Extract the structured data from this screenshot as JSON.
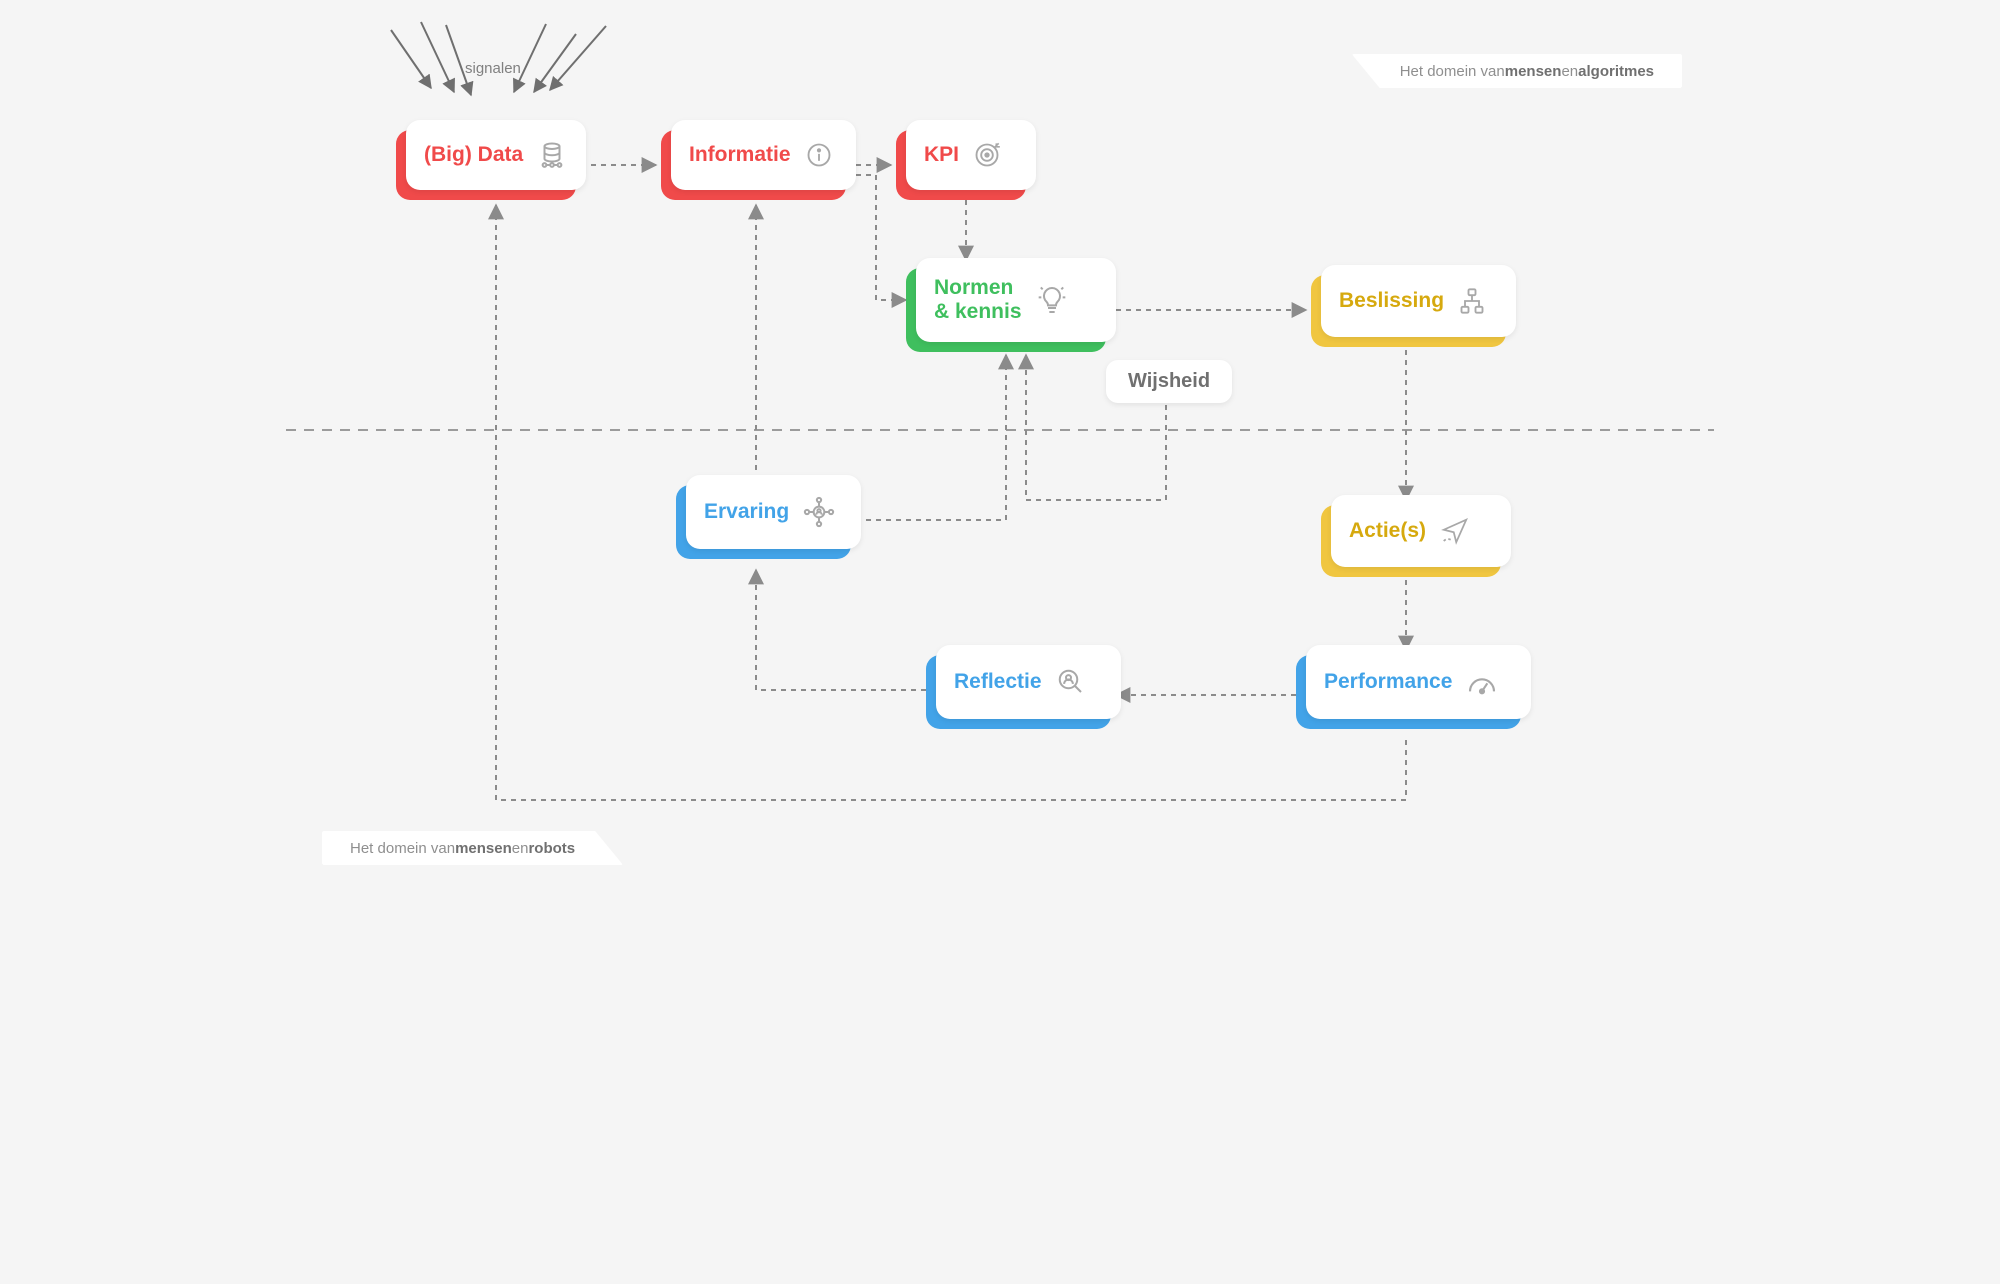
{
  "signal_label": "signalen",
  "domain_top": {
    "prefix": "Het domein van ",
    "bold1": "mensen",
    "mid": " en ",
    "bold2": "algoritmes"
  },
  "domain_bottom": {
    "prefix": "Het domein van ",
    "bold1": "mensen",
    "mid": " en ",
    "bold2": "robots"
  },
  "nodes": {
    "bigdata": {
      "label": "(Big) Data"
    },
    "informatie": {
      "label": "Informatie"
    },
    "kpi": {
      "label": "KPI"
    },
    "normen": {
      "label": "Normen\n& kennis"
    },
    "wijsheid": {
      "label": "Wijsheid"
    },
    "beslissing": {
      "label": "Beslissing"
    },
    "acties": {
      "label": "Actie(s)"
    },
    "performance": {
      "label": "Performance"
    },
    "reflectie": {
      "label": "Reflectie"
    },
    "ervaring": {
      "label": "Ervaring"
    }
  },
  "colors": {
    "red": "#f04a4a",
    "green": "#3fbf5e",
    "yellow": "#f0c640",
    "blue": "#42a3e8",
    "gray": "#9b9b9b"
  }
}
